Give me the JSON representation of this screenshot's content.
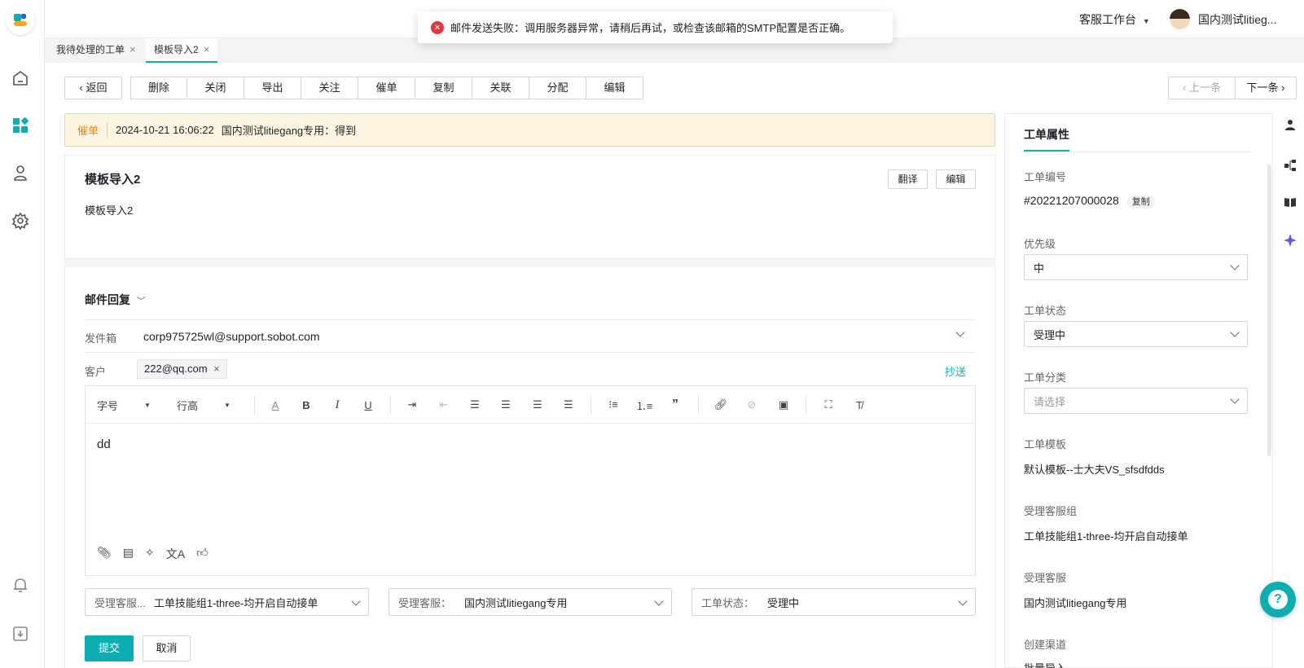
{
  "toast": {
    "message": "邮件发送失败：调用服务器异常，请稍后再试，或检查该邮箱的SMTP配置是否正确。"
  },
  "topbar": {
    "workspace": "客服工作台",
    "user": "国内测试litieg..."
  },
  "tabs": [
    {
      "label": "我待处理的工单"
    },
    {
      "label": "模板导入2"
    }
  ],
  "actions": {
    "back": "返回",
    "buttons": [
      "删除",
      "关闭",
      "导出",
      "关注",
      "催单",
      "复制",
      "关联",
      "分配",
      "编辑"
    ],
    "prev": "上一条",
    "next": "下一条"
  },
  "alert": {
    "tag": "催单",
    "time": "2024-10-21 16:06:22",
    "text": "国内测试litiegang专用：得到"
  },
  "ticket": {
    "title": "模板导入2",
    "body": "模板导入2",
    "translate": "翻译",
    "edit": "编辑"
  },
  "reply": {
    "title": "邮件回复",
    "from_label": "发件箱",
    "from_value": "corp975725wl@support.sobot.com",
    "customer_label": "客户",
    "customer_tag": "222@qq.com",
    "cc": "抄送",
    "font_size": "字号",
    "line_height": "行高",
    "content": "dd",
    "group_label": "受理客服...",
    "group_value": "工单技能组1-three-均开启自动接单",
    "agent_label": "受理客服：",
    "agent_value": "国内测试litiegang专用",
    "status_label": "工单状态：",
    "status_value": "受理中",
    "submit": "提交",
    "cancel": "取消"
  },
  "props": {
    "title": "工单属性",
    "id_label": "工单编号",
    "id_value": "#20221207000028",
    "copy": "复制",
    "priority_label": "优先级",
    "priority_value": "中",
    "status_label": "工单状态",
    "status_value": "受理中",
    "category_label": "工单分类",
    "category_placeholder": "请选择",
    "template_label": "工单模板",
    "template_value": "默认模板--士大夫VS_sfsdfdds",
    "group_label": "受理客服组",
    "group_value": "工单技能组1-three-均开启自动接单",
    "agent_label": "受理客服",
    "agent_value": "国内测试litiegang专用",
    "channel_label": "创建渠道",
    "channel_value": "批量导入"
  },
  "colors": {
    "accent": "#0daeb1",
    "error": "#e5323e",
    "warning_bg": "#fdf5e1"
  }
}
